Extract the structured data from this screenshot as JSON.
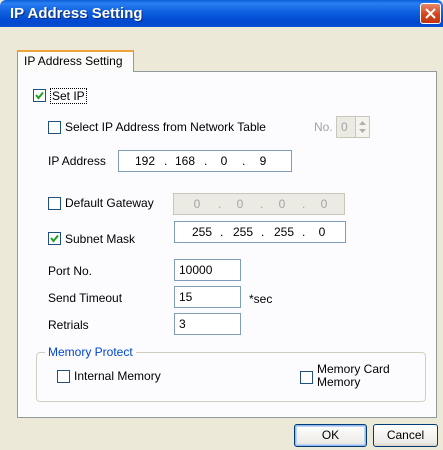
{
  "window": {
    "title": "IP Address Setting"
  },
  "tabs": [
    {
      "label": "IP Address Setting"
    }
  ],
  "set_ip": {
    "label": "Set IP",
    "checked": true
  },
  "network_table": {
    "label": "Select IP Address from Network Table",
    "checked": false,
    "no_label": "No.",
    "no_value": "0"
  },
  "ip_address": {
    "label": "IP Address",
    "octets": [
      "192",
      "168",
      "0",
      "9"
    ]
  },
  "default_gateway": {
    "label": "Default Gateway",
    "checked": false,
    "octets": [
      "0",
      "0",
      "0",
      "0"
    ]
  },
  "subnet_mask": {
    "label": "Subnet Mask",
    "checked": true,
    "octets": [
      "255",
      "255",
      "255",
      "0"
    ]
  },
  "port": {
    "label": "Port No.",
    "value": "10000"
  },
  "send_timeout": {
    "label": "Send Timeout",
    "value": "15",
    "unit": "*sec"
  },
  "retrials": {
    "label": "Retrials",
    "value": "3"
  },
  "memory_protect": {
    "title": "Memory Protect",
    "internal": {
      "label": "Internal Memory",
      "checked": false
    },
    "card": {
      "label_line1": "Memory Card",
      "label_line2": "Memory",
      "checked": false
    }
  },
  "buttons": {
    "ok": "OK",
    "cancel": "Cancel"
  },
  "colors": {
    "titlebar": "#0a4fcf",
    "dialog_bg": "#ece9d8",
    "group_title": "#0046d5",
    "checkmark": "#21a121"
  }
}
